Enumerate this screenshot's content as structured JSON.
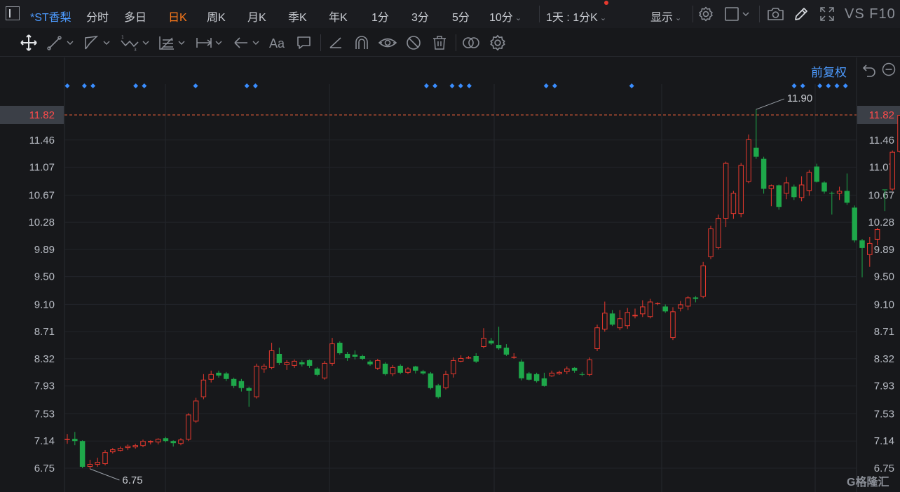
{
  "header": {
    "stock_name": "*ST香梨",
    "period_tabs": [
      {
        "label": "分时"
      },
      {
        "label": "多日"
      },
      {
        "label": "日K"
      },
      {
        "label": "周K"
      },
      {
        "label": "月K"
      },
      {
        "label": "季K"
      },
      {
        "label": "年K"
      },
      {
        "label": "1分"
      },
      {
        "label": "3分"
      },
      {
        "label": "5分"
      },
      {
        "label": "10分"
      },
      {
        "label": "1天 : 1分K"
      }
    ],
    "active_tab": "日K",
    "display_label": "显示",
    "compare_label": "VS F10"
  },
  "toolbar": {
    "tools": [
      "move-icon",
      "line-icon",
      "channel-icon",
      "wave-icon",
      "fib-icon",
      "measure-icon",
      "arrow-icon",
      "text-icon",
      "note-icon",
      "pen-icon",
      "magnet-icon",
      "eye-icon",
      "hide-icon",
      "trash-icon",
      "link-icon",
      "settings-icon"
    ],
    "text_tool_label": "Aa"
  },
  "chart_panel": {
    "adjust_label": "前复权",
    "watermark": "G格隆汇"
  },
  "chart_data": {
    "type": "candlestick",
    "title": "",
    "y_ticks": [
      "11.82",
      "11.46",
      "11.07",
      "10.67",
      "10.28",
      "9.89",
      "9.50",
      "9.10",
      "8.71",
      "8.32",
      "7.93",
      "7.53",
      "7.14",
      "6.75"
    ],
    "ylim": [
      6.75,
      11.82
    ],
    "current_price": "11.82",
    "high_label": "11.90",
    "low_label": "6.75",
    "up_color": "#e8392e",
    "down_color": "#1ea84a",
    "candles": [
      [
        7.16,
        7.17,
        7.1,
        7.24
      ],
      [
        7.17,
        7.14,
        7.08,
        7.27
      ],
      [
        7.14,
        6.77,
        6.75,
        7.15
      ],
      [
        6.77,
        6.81,
        6.74,
        6.87
      ],
      [
        6.8,
        6.84,
        6.77,
        6.9
      ],
      [
        6.81,
        6.98,
        6.79,
        7.01
      ],
      [
        6.98,
        7.02,
        6.96,
        7.04
      ],
      [
        7.0,
        7.04,
        6.99,
        7.06
      ],
      [
        7.04,
        7.07,
        7.01,
        7.09
      ],
      [
        7.05,
        7.08,
        7.03,
        7.1
      ],
      [
        7.07,
        7.14,
        7.05,
        7.16
      ],
      [
        7.12,
        7.14,
        7.09,
        7.15
      ],
      [
        7.12,
        7.17,
        7.09,
        7.18
      ],
      [
        7.18,
        7.14,
        7.12,
        7.2
      ],
      [
        7.14,
        7.11,
        7.06,
        7.15
      ],
      [
        7.1,
        7.16,
        7.08,
        7.18
      ],
      [
        7.16,
        7.52,
        7.14,
        7.54
      ],
      [
        7.42,
        7.72,
        7.4,
        7.76
      ],
      [
        7.77,
        8.02,
        7.74,
        8.1
      ],
      [
        8.02,
        8.1,
        7.98,
        8.15
      ],
      [
        8.12,
        8.08,
        8.05,
        8.15
      ],
      [
        8.11,
        8.03,
        8.0,
        8.13
      ],
      [
        8.03,
        7.93,
        7.9,
        8.05
      ],
      [
        8.0,
        7.9,
        7.85,
        8.03
      ],
      [
        7.9,
        7.86,
        7.63,
        7.92
      ],
      [
        7.77,
        8.22,
        7.75,
        8.25
      ],
      [
        8.17,
        8.22,
        8.12,
        8.25
      ],
      [
        8.19,
        8.44,
        8.17,
        8.55
      ],
      [
        8.39,
        8.26,
        8.23,
        8.48
      ],
      [
        8.23,
        8.27,
        8.16,
        8.3
      ],
      [
        8.22,
        8.29,
        8.19,
        8.31
      ],
      [
        8.27,
        8.24,
        8.21,
        8.3
      ],
      [
        8.3,
        8.22,
        8.19,
        8.31
      ],
      [
        8.18,
        8.09,
        8.07,
        8.2
      ],
      [
        8.04,
        8.26,
        8.02,
        8.29
      ],
      [
        8.25,
        8.54,
        8.22,
        8.62
      ],
      [
        8.55,
        8.4,
        8.38,
        8.57
      ],
      [
        8.39,
        8.33,
        8.29,
        8.42
      ],
      [
        8.38,
        8.35,
        8.31,
        8.44
      ],
      [
        8.36,
        8.32,
        8.3,
        8.38
      ],
      [
        8.28,
        8.24,
        8.22,
        8.3
      ],
      [
        8.18,
        8.3,
        8.16,
        8.32
      ],
      [
        8.25,
        8.1,
        8.08,
        8.27
      ],
      [
        8.1,
        8.2,
        8.07,
        8.23
      ],
      [
        8.22,
        8.12,
        8.1,
        8.24
      ],
      [
        8.12,
        8.18,
        8.1,
        8.2
      ],
      [
        8.21,
        8.15,
        8.11,
        8.22
      ],
      [
        8.14,
        8.11,
        8.09,
        8.16
      ],
      [
        8.11,
        7.9,
        7.88,
        8.13
      ],
      [
        7.94,
        7.77,
        7.75,
        7.96
      ],
      [
        7.9,
        8.1,
        7.88,
        8.15
      ],
      [
        8.1,
        8.3,
        8.05,
        8.34
      ],
      [
        8.28,
        8.33,
        8.27,
        8.37
      ],
      [
        8.33,
        8.34,
        8.32,
        8.36
      ],
      [
        8.36,
        8.28,
        8.26,
        8.4
      ],
      [
        8.49,
        8.62,
        8.47,
        8.76
      ],
      [
        8.58,
        8.54,
        8.52,
        8.62
      ],
      [
        8.52,
        8.47,
        8.45,
        8.78
      ],
      [
        8.48,
        8.38,
        8.36,
        8.53
      ],
      [
        8.35,
        8.35,
        8.32,
        8.4
      ],
      [
        8.28,
        8.04,
        8.01,
        8.31
      ],
      [
        8.11,
        8.02,
        8.01,
        8.13
      ],
      [
        8.1,
        8.0,
        7.98,
        8.12
      ],
      [
        8.04,
        7.93,
        7.92,
        8.12
      ],
      [
        8.07,
        8.12,
        8.06,
        8.15
      ],
      [
        8.1,
        8.13,
        8.09,
        8.15
      ],
      [
        8.13,
        8.18,
        8.1,
        8.21
      ],
      [
        8.19,
        8.15,
        8.12,
        8.2
      ],
      [
        8.1,
        8.09,
        8.07,
        8.13
      ],
      [
        8.09,
        8.31,
        8.07,
        8.34
      ],
      [
        8.46,
        8.77,
        8.43,
        8.81
      ],
      [
        8.74,
        8.98,
        8.71,
        9.14
      ],
      [
        8.97,
        8.81,
        8.79,
        9.02
      ],
      [
        8.76,
        8.9,
        8.73,
        9.02
      ],
      [
        8.79,
        8.99,
        8.75,
        9.05
      ],
      [
        8.93,
        8.95,
        8.9,
        9.04
      ],
      [
        8.96,
        9.07,
        8.92,
        9.16
      ],
      [
        8.92,
        9.14,
        8.9,
        9.18
      ],
      [
        9.11,
        9.12,
        9.09,
        9.13
      ],
      [
        9.07,
        9.0,
        8.98,
        9.1
      ],
      [
        8.62,
        9.0,
        8.59,
        9.06
      ],
      [
        9.04,
        9.1,
        9.0,
        9.15
      ],
      [
        9.07,
        9.2,
        9.02,
        9.22
      ],
      [
        9.2,
        9.18,
        9.13,
        9.22
      ],
      [
        9.21,
        9.66,
        9.19,
        9.71
      ],
      [
        9.78,
        10.19,
        9.75,
        10.23
      ],
      [
        9.91,
        10.34,
        9.89,
        10.39
      ],
      [
        10.33,
        11.13,
        10.21,
        11.15
      ],
      [
        10.4,
        10.7,
        10.33,
        10.73
      ],
      [
        10.4,
        11.1,
        10.35,
        11.13
      ],
      [
        10.86,
        11.47,
        10.84,
        11.54
      ],
      [
        11.35,
        11.22,
        11.19,
        11.9
      ],
      [
        11.19,
        10.76,
        10.69,
        11.22
      ],
      [
        10.76,
        10.81,
        10.51,
        10.82
      ],
      [
        10.81,
        10.5,
        10.46,
        10.82
      ],
      [
        10.69,
        10.85,
        10.61,
        10.93
      ],
      [
        10.79,
        10.64,
        10.6,
        10.82
      ],
      [
        10.63,
        10.82,
        10.58,
        10.94
      ],
      [
        10.73,
        11.0,
        10.66,
        11.03
      ],
      [
        11.08,
        10.86,
        10.85,
        11.12
      ],
      [
        10.85,
        10.72,
        10.69,
        10.87
      ],
      [
        10.7,
        10.69,
        10.39,
        10.72
      ],
      [
        10.69,
        10.73,
        10.6,
        10.79
      ],
      [
        10.73,
        10.56,
        10.53,
        10.98
      ],
      [
        10.49,
        10.02,
        9.99,
        10.52
      ],
      [
        10.02,
        9.91,
        9.49,
        10.04
      ],
      [
        9.81,
        9.98,
        9.64,
        10.07
      ],
      [
        10.03,
        10.18,
        9.95,
        10.2
      ],
      [
        10.75,
        10.74,
        10.44,
        10.74
      ],
      [
        10.75,
        11.29,
        10.73,
        11.31
      ],
      [
        11.29,
        11.82,
        11.28,
        11.82
      ]
    ],
    "marker_columns": [
      0,
      2,
      3,
      8,
      9,
      15,
      21,
      22,
      42,
      43,
      45,
      46,
      47,
      56,
      57,
      66,
      85,
      86,
      88,
      89,
      90,
      91
    ]
  }
}
